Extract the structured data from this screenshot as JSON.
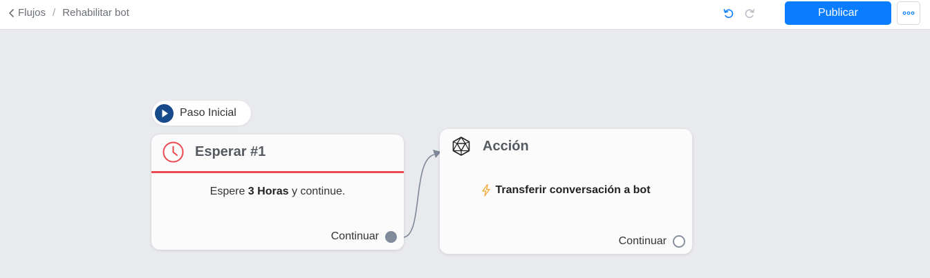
{
  "header": {
    "back_label": "Flujos",
    "separator": "/",
    "current": "Rehabilitar bot",
    "publish_label": "Publicar",
    "colors": {
      "accent": "#0a7cff",
      "undo_active": "#0a7cff",
      "redo_disabled": "#b8bcc3"
    }
  },
  "start": {
    "label": "Paso Inicial",
    "icon": "play-icon",
    "color": "#174a8b"
  },
  "wait_card": {
    "icon": "clock-icon",
    "title": "Esperar #1",
    "text_before": "Espere",
    "duration": "3 Horas",
    "text_after": "y continue.",
    "port_label": "Continuar",
    "accent": "#ea4a4f"
  },
  "action_card": {
    "icon": "icosahedron-icon",
    "title": "Acción",
    "action_icon": "lightning-icon",
    "action_text": "Transferir conversación a bot",
    "port_label": "Continuar"
  }
}
